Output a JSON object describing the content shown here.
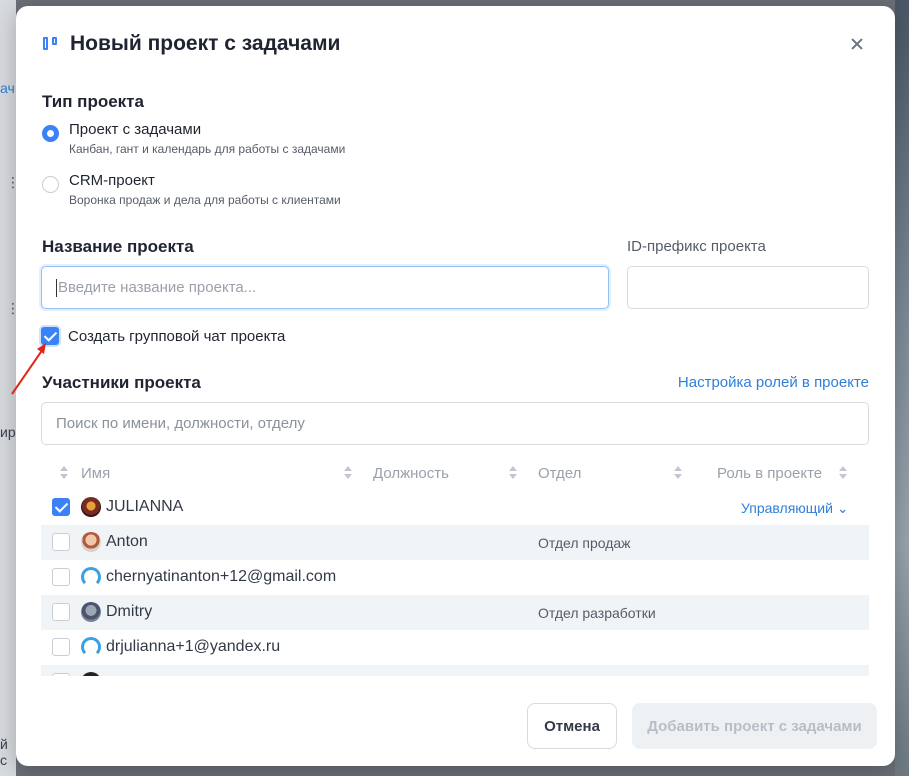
{
  "colors": {
    "accent": "#3b82f6",
    "link": "#2f7fd8",
    "annotation_arrow": "#e0251b"
  },
  "background": {
    "left_fragments": [
      "ач",
      "ир",
      "й с"
    ]
  },
  "modal": {
    "title": "Новый проект с задачами",
    "title_icon": "kanban-icon",
    "close_icon": "close-icon"
  },
  "project_type": {
    "label": "Тип проекта",
    "options": [
      {
        "title": "Проект с задачами",
        "desc": "Канбан, гант и календарь для работы с задачами",
        "selected": true
      },
      {
        "title": "CRM-проект",
        "desc": "Воронка продаж и дела для работы с клиентами",
        "selected": false
      }
    ]
  },
  "project_name": {
    "label": "Название проекта",
    "placeholder": "Введите название проекта...",
    "value": ""
  },
  "id_prefix": {
    "label": "ID-префикс проекта",
    "value": ""
  },
  "group_chat": {
    "label": "Создать групповой чат проекта",
    "checked": true
  },
  "members": {
    "label": "Участники проекта",
    "roles_link": "Настройка ролей в проекте",
    "search_placeholder": "Поиск по имени, должности, отделу",
    "columns": [
      "Имя",
      "Должность",
      "Отдел",
      "Роль в проекте"
    ],
    "rows": [
      {
        "checked": true,
        "avatar": "user1",
        "name": "JULIANNA",
        "position": "",
        "dept": "",
        "role": "Управляющий"
      },
      {
        "checked": false,
        "avatar": "user2",
        "name": "Anton",
        "position": "",
        "dept": "Отдел продаж",
        "role": ""
      },
      {
        "checked": false,
        "avatar": "generic",
        "name": "chernyatinanton+12@gmail.com",
        "position": "",
        "dept": "",
        "role": ""
      },
      {
        "checked": false,
        "avatar": "user3",
        "name": "Dmitry",
        "position": "",
        "dept": "Отдел разработки",
        "role": ""
      },
      {
        "checked": false,
        "avatar": "generic",
        "name": "drjulianna+1@yandex.ru",
        "position": "",
        "dept": "",
        "role": ""
      }
    ]
  },
  "footer": {
    "cancel": "Отмена",
    "submit": "Добавить проект с задачами",
    "submit_disabled": true
  }
}
